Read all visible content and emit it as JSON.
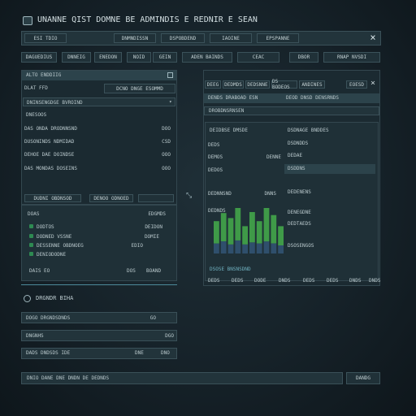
{
  "app": {
    "title": "UNANNE QIST DOMNE BE ADMINDIS E REDNIR E SEAN",
    "logo_icon": "app-logo-icon"
  },
  "toolbar": {
    "tab_main": "ESI TDIO",
    "items": [
      "DNMNDISSN",
      "DSPOBDEND",
      "IAOINE",
      "EPSPANNE"
    ],
    "close_label": "×"
  },
  "filters": [
    "DAGUEDIUS",
    "DNNEIG",
    "ENEDON",
    "NOID",
    "GEIN",
    "ADEN BAINDS",
    "CEAC",
    "DBOR",
    "RNAP NVSDI"
  ],
  "left_panel": {
    "header": "ALTO ENDDIIG",
    "subheader": {
      "label": "DLAT FFD",
      "value": "DCNO DNGE ESOMMD"
    },
    "dropdown": "DNINSENGDGE BVROIND",
    "section_label": "DNESOOS",
    "rows": [
      {
        "label": "DAS ONDA DRODNNSND",
        "value": "DOO"
      },
      {
        "label": "DUSONINDS NDMIDAD",
        "value": "CSD"
      },
      {
        "label": "DEHOE DAE DOINDSE",
        "value": "OOO"
      },
      {
        "label": "DAS MONDAS DOSEINS",
        "value": "OOO"
      }
    ],
    "footer_buttons": [
      "DUDNI OBDNSOD",
      "DENOO ODNOED"
    ],
    "list_header": {
      "left": "DOAS",
      "right": "EDGMDS"
    },
    "list_rows": [
      {
        "label": "DODTOS",
        "value": "DEIDON"
      },
      {
        "label": "DODNED VSSNE",
        "value": "DOMIE"
      },
      {
        "label": "DESSENNE OBDNOEG",
        "value": "EDIO"
      },
      {
        "label": "DENIODODNE",
        "value": ""
      }
    ],
    "list_footer": {
      "left": "DAIS EO",
      "mid": "DOS",
      "right": "BOAND"
    }
  },
  "bottom_left": {
    "section_title": "DRGNDR BIHA",
    "rows": [
      {
        "label": "DOGO DRGNDSDNDS",
        "mid": "",
        "value": "GO"
      },
      {
        "label": "DNGNHS",
        "mid": "",
        "value": "DGO"
      },
      {
        "label": "DADS DNDSDS IDE",
        "mid": "DNE",
        "value": "DNO"
      }
    ]
  },
  "right_panel": {
    "tabs": [
      "DEEG",
      "DEDMDS",
      "DEDSNNE",
      "DS BODEOS",
      "ANDINES",
      "EOESD"
    ],
    "close_label": "×",
    "row1": {
      "left": "DENDS DRABOAD ESN",
      "right": "DEOD DNSD DENSRNDS"
    },
    "row2": "DROBDNSRNSEN",
    "inner": {
      "left_header": "DEIDBSE DMSDE",
      "right_header": "DSDNAGE BNDDES",
      "left_rows": [
        {
          "label": "DEDS",
          "value": ""
        },
        {
          "label": "DEMOS",
          "value": "DENNE"
        },
        {
          "label": "DEDOS",
          "value": ""
        },
        {
          "label": "DEDNNSND",
          "value": "DNNS"
        }
      ],
      "right_rows": [
        "DSDNDDS",
        "DEDAE",
        "DSDDNS",
        "DEDENENS"
      ],
      "chart_label": "DEDNDS",
      "chart_right_rows": [
        "DENEGDNE",
        "DEDTAEDS",
        "DSOSENGOS"
      ],
      "chart_bottom_label": "DSOSE BNSNSDND"
    },
    "axis_labels": [
      "DEDS",
      "DEDS",
      "DODE",
      "DNDS",
      "DEDS",
      "DEDS",
      "DNDS",
      "DNDS"
    ],
    "handle_icon": "resize-handle-icon"
  },
  "chart_data": {
    "type": "bar",
    "series": [
      {
        "values": [
          10,
          12,
          9,
          13,
          9,
          11,
          10,
          12,
          10,
          8
        ]
      },
      {
        "values": [
          22,
          28,
          26,
          33,
          18,
          30,
          22,
          33,
          28,
          19
        ]
      }
    ],
    "colors": [
      "#2f4f6c",
      "#3f9a48"
    ]
  },
  "footer_bar": {
    "input_text": "DNIO   DANE DNE DNDN DE DEDNDS",
    "button_label": "DANDG"
  },
  "colors": {
    "accent": "#4d8a9a",
    "bar_green": "#3f9a48",
    "bar_blue": "#2f4f6c"
  }
}
